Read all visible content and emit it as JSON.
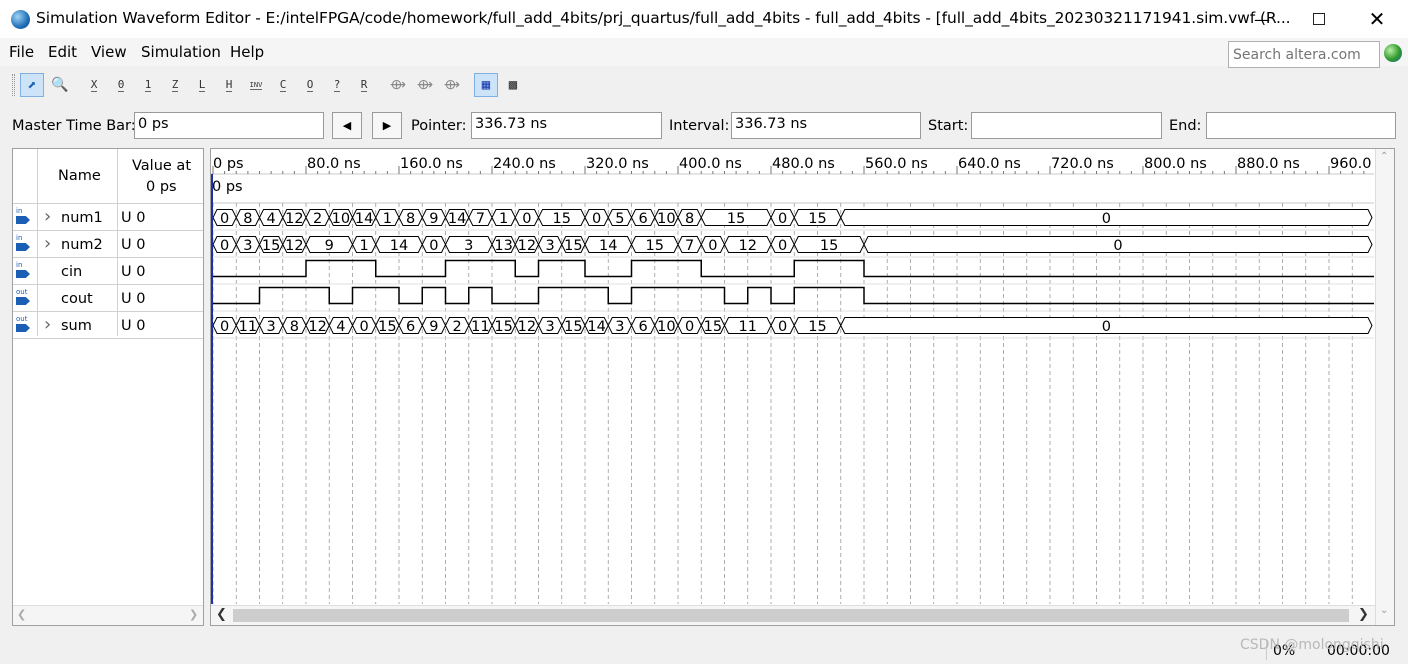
{
  "window": {
    "title": "Simulation Waveform Editor - E:/intelFPGA/code/homework/full_add_4bits/prj_quartus/full_add_4bits - full_add_4bits - [full_add_4bits_20230321171941.sim.vwf (R...",
    "minimize_icon": "minimize-icon",
    "maximize_icon": "maximize-icon",
    "close_icon": "close-icon"
  },
  "menu": {
    "items": [
      {
        "label": "File"
      },
      {
        "label": "Edit"
      },
      {
        "label": "View"
      },
      {
        "label": "Simulation"
      },
      {
        "label": "Help"
      }
    ],
    "search_placeholder": "Search altera.com"
  },
  "toolbar": {
    "tools": [
      {
        "icon": "pointer-icon",
        "text": ""
      },
      {
        "icon": "zoom-icon",
        "text": ""
      },
      {
        "icon": "force-unknown-icon",
        "text": "X"
      },
      {
        "icon": "force-low-icon",
        "text": "0"
      },
      {
        "icon": "force-high-icon",
        "text": "1"
      },
      {
        "icon": "force-high-impedance-icon",
        "text": "Z"
      },
      {
        "icon": "force-weak-low-icon",
        "text": "L"
      },
      {
        "icon": "force-weak-high-icon",
        "text": "H"
      },
      {
        "icon": "invert-icon",
        "text": "INV"
      },
      {
        "icon": "count-value-icon",
        "text": "C"
      },
      {
        "icon": "overwrite-clock-icon",
        "text": "O"
      },
      {
        "icon": "arbitrary-value-icon",
        "text": "?"
      },
      {
        "icon": "random-values-icon",
        "text": "R"
      },
      {
        "icon": "run-functional-simulation-icon",
        "text": ""
      },
      {
        "icon": "run-timing-simulation-icon",
        "text": ""
      },
      {
        "icon": "generate-netlist-icon",
        "text": ""
      },
      {
        "icon": "snap-to-grid-icon",
        "text": ""
      },
      {
        "icon": "grid-view-icon",
        "text": ""
      }
    ]
  },
  "timebar": {
    "master_label": "Master Time Bar:",
    "master_value": "0 ps",
    "pointer_label": "Pointer:",
    "pointer_value": "336.73 ns",
    "interval_label": "Interval:",
    "interval_value": "336.73 ns",
    "start_label": "Start:",
    "start_value": "",
    "end_label": "End:",
    "end_value": ""
  },
  "signal_table": {
    "name_header": "Name",
    "value_header_line1": "Value at",
    "value_header_line2": "0 ps",
    "signals": [
      {
        "name": "num1",
        "value": "U 0",
        "dir": "in",
        "bus": true
      },
      {
        "name": "num2",
        "value": "U 0",
        "dir": "in",
        "bus": true
      },
      {
        "name": "cin",
        "value": "U 0",
        "dir": "in",
        "bus": false
      },
      {
        "name": "cout",
        "value": "U 0",
        "dir": "out",
        "bus": false
      },
      {
        "name": "sum",
        "value": "U 0",
        "dir": "out",
        "bus": true
      }
    ]
  },
  "waveform": {
    "time_ticks": [
      "0 ps",
      "80.0 ns",
      "160.0 ns",
      "240.0 ns",
      "320.0 ns",
      "400.0 ns",
      "480.0 ns",
      "560.0 ns",
      "640.0 ns",
      "720.0 ns",
      "800.0 ns",
      "880.0 ns",
      "960.0 ns"
    ],
    "cursor_label": "0 ps",
    "buses": {
      "num1": {
        "segments": [
          {
            "start": 0,
            "end": 20,
            "label": "0"
          },
          {
            "start": 20,
            "end": 40,
            "label": "8"
          },
          {
            "start": 40,
            "end": 60,
            "label": "4"
          },
          {
            "start": 60,
            "end": 80,
            "label": "12"
          },
          {
            "start": 80,
            "end": 100,
            "label": "2"
          },
          {
            "start": 100,
            "end": 120,
            "label": "10"
          },
          {
            "start": 120,
            "end": 140,
            "label": "14"
          },
          {
            "start": 140,
            "end": 160,
            "label": "1"
          },
          {
            "start": 160,
            "end": 180,
            "label": "8"
          },
          {
            "start": 180,
            "end": 200,
            "label": "9"
          },
          {
            "start": 200,
            "end": 220,
            "label": "14"
          },
          {
            "start": 220,
            "end": 240,
            "label": "7"
          },
          {
            "start": 240,
            "end": 260,
            "label": "1"
          },
          {
            "start": 260,
            "end": 280,
            "label": "0"
          },
          {
            "start": 280,
            "end": 320,
            "label": "15"
          },
          {
            "start": 320,
            "end": 340,
            "label": "0"
          },
          {
            "start": 340,
            "end": 360,
            "label": "5"
          },
          {
            "start": 360,
            "end": 380,
            "label": "6"
          },
          {
            "start": 380,
            "end": 400,
            "label": "10"
          },
          {
            "start": 400,
            "end": 420,
            "label": "8"
          },
          {
            "start": 420,
            "end": 480,
            "label": "15"
          },
          {
            "start": 480,
            "end": 500,
            "label": "0"
          },
          {
            "start": 500,
            "end": 540,
            "label": "15"
          },
          {
            "start": 540,
            "end": 1000,
            "label": "0"
          }
        ]
      },
      "num2": {
        "segments": [
          {
            "start": 0,
            "end": 20,
            "label": "0"
          },
          {
            "start": 20,
            "end": 40,
            "label": "3"
          },
          {
            "start": 40,
            "end": 60,
            "label": "15"
          },
          {
            "start": 60,
            "end": 80,
            "label": "12"
          },
          {
            "start": 80,
            "end": 120,
            "label": "9"
          },
          {
            "start": 120,
            "end": 140,
            "label": "1"
          },
          {
            "start": 140,
            "end": 180,
            "label": "14"
          },
          {
            "start": 180,
            "end": 200,
            "label": "0"
          },
          {
            "start": 200,
            "end": 240,
            "label": "3"
          },
          {
            "start": 240,
            "end": 260,
            "label": "13"
          },
          {
            "start": 260,
            "end": 280,
            "label": "12"
          },
          {
            "start": 280,
            "end": 300,
            "label": "3"
          },
          {
            "start": 300,
            "end": 320,
            "label": "15"
          },
          {
            "start": 320,
            "end": 360,
            "label": "14"
          },
          {
            "start": 360,
            "end": 400,
            "label": "15"
          },
          {
            "start": 400,
            "end": 420,
            "label": "7"
          },
          {
            "start": 420,
            "end": 440,
            "label": "0"
          },
          {
            "start": 440,
            "end": 480,
            "label": "12"
          },
          {
            "start": 480,
            "end": 500,
            "label": "0"
          },
          {
            "start": 500,
            "end": 560,
            "label": "15"
          },
          {
            "start": 560,
            "end": 1000,
            "label": "0"
          }
        ]
      },
      "sum": {
        "segments": [
          {
            "start": 0,
            "end": 20,
            "label": "0"
          },
          {
            "start": 20,
            "end": 40,
            "label": "11"
          },
          {
            "start": 40,
            "end": 60,
            "label": "3"
          },
          {
            "start": 60,
            "end": 80,
            "label": "8"
          },
          {
            "start": 80,
            "end": 100,
            "label": "12"
          },
          {
            "start": 100,
            "end": 120,
            "label": "4"
          },
          {
            "start": 120,
            "end": 140,
            "label": "0"
          },
          {
            "start": 140,
            "end": 160,
            "label": "15"
          },
          {
            "start": 160,
            "end": 180,
            "label": "6"
          },
          {
            "start": 180,
            "end": 200,
            "label": "9"
          },
          {
            "start": 200,
            "end": 220,
            "label": "2"
          },
          {
            "start": 220,
            "end": 240,
            "label": "11"
          },
          {
            "start": 240,
            "end": 260,
            "label": "15"
          },
          {
            "start": 260,
            "end": 280,
            "label": "12"
          },
          {
            "start": 280,
            "end": 300,
            "label": "3"
          },
          {
            "start": 300,
            "end": 320,
            "label": "15"
          },
          {
            "start": 320,
            "end": 340,
            "label": "14"
          },
          {
            "start": 340,
            "end": 360,
            "label": "3"
          },
          {
            "start": 360,
            "end": 380,
            "label": "6"
          },
          {
            "start": 380,
            "end": 400,
            "label": "10"
          },
          {
            "start": 400,
            "end": 420,
            "label": "0"
          },
          {
            "start": 420,
            "end": 440,
            "label": "15"
          },
          {
            "start": 440,
            "end": 480,
            "label": "11"
          },
          {
            "start": 480,
            "end": 500,
            "label": "0"
          },
          {
            "start": 500,
            "end": 540,
            "label": "15"
          },
          {
            "start": 540,
            "end": 1000,
            "label": "0"
          }
        ]
      }
    },
    "bits": {
      "cin": [
        {
          "t": 0,
          "v": 0
        },
        {
          "t": 80,
          "v": 1
        },
        {
          "t": 140,
          "v": 0
        },
        {
          "t": 200,
          "v": 1
        },
        {
          "t": 260,
          "v": 0
        },
        {
          "t": 280,
          "v": 1
        },
        {
          "t": 320,
          "v": 0
        },
        {
          "t": 360,
          "v": 1
        },
        {
          "t": 420,
          "v": 0
        },
        {
          "t": 500,
          "v": 1
        },
        {
          "t": 560,
          "v": 0
        }
      ],
      "cout": [
        {
          "t": 0,
          "v": 0
        },
        {
          "t": 40,
          "v": 1
        },
        {
          "t": 100,
          "v": 0
        },
        {
          "t": 120,
          "v": 1
        },
        {
          "t": 160,
          "v": 0
        },
        {
          "t": 180,
          "v": 1
        },
        {
          "t": 200,
          "v": 0
        },
        {
          "t": 220,
          "v": 1
        },
        {
          "t": 240,
          "v": 0
        },
        {
          "t": 280,
          "v": 1
        },
        {
          "t": 340,
          "v": 0
        },
        {
          "t": 360,
          "v": 1
        },
        {
          "t": 440,
          "v": 0
        },
        {
          "t": 460,
          "v": 1
        },
        {
          "t": 480,
          "v": 0
        },
        {
          "t": 500,
          "v": 1
        },
        {
          "t": 560,
          "v": 0
        }
      ]
    }
  },
  "status": {
    "progress": "0%",
    "elapsed": "00:00:00",
    "watermark": "CSDN @molongqishi"
  },
  "colors": {
    "wave": "#000000",
    "bus_fill": "#ffffff",
    "grid": "#9a9a9a",
    "cursor": "#1f2fa8",
    "highlight": "#cde3f7"
  }
}
